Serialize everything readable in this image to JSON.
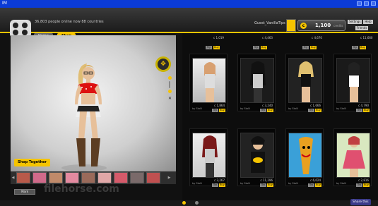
{
  "window": {
    "title": "IM"
  },
  "header": {
    "status": "36,803 people online now 88 countries",
    "tabs": [
      "Home",
      "Shop"
    ],
    "username": "Guest_VanillaTips",
    "credits": "1,100",
    "credits_label": "credits",
    "menu": [
      "Settings",
      "Help"
    ],
    "friends": "Friends"
  },
  "scene": {
    "shop_together": "Shop Together",
    "watermark": "filehorse.com",
    "bottom_btn": "Mark"
  },
  "catalog": {
    "top_prices": [
      "c 1,019",
      "c 4,463",
      "c 4,670",
      "c 11,660"
    ],
    "items": [
      {
        "price": "c 1,864",
        "name": "by Stolli",
        "buy": "Buy",
        "try": "Try"
      },
      {
        "price": "c 3,240",
        "name": "by Stolli",
        "buy": "Buy",
        "try": "Try"
      },
      {
        "price": "c 1,666",
        "name": "by Stolli",
        "buy": "Buy",
        "try": "Try"
      },
      {
        "price": "c 4,790",
        "name": "by Stolli",
        "buy": "Buy",
        "try": "Try"
      },
      {
        "price": "c 3,267",
        "name": "by Stolli",
        "buy": "Buy",
        "try": "Try"
      },
      {
        "price": "c 11,296",
        "name": "by Stolli",
        "buy": "Buy",
        "try": "Try"
      },
      {
        "price": "c 6,024",
        "name": "by Stolli",
        "buy": "Buy",
        "try": "Try"
      },
      {
        "price": "c 2,816",
        "name": "by Stolli",
        "buy": "Buy",
        "try": "Try"
      }
    ],
    "share": "Share this"
  },
  "colors": {
    "accent": "#f5c400",
    "titlebar": "#0b3bd6"
  }
}
